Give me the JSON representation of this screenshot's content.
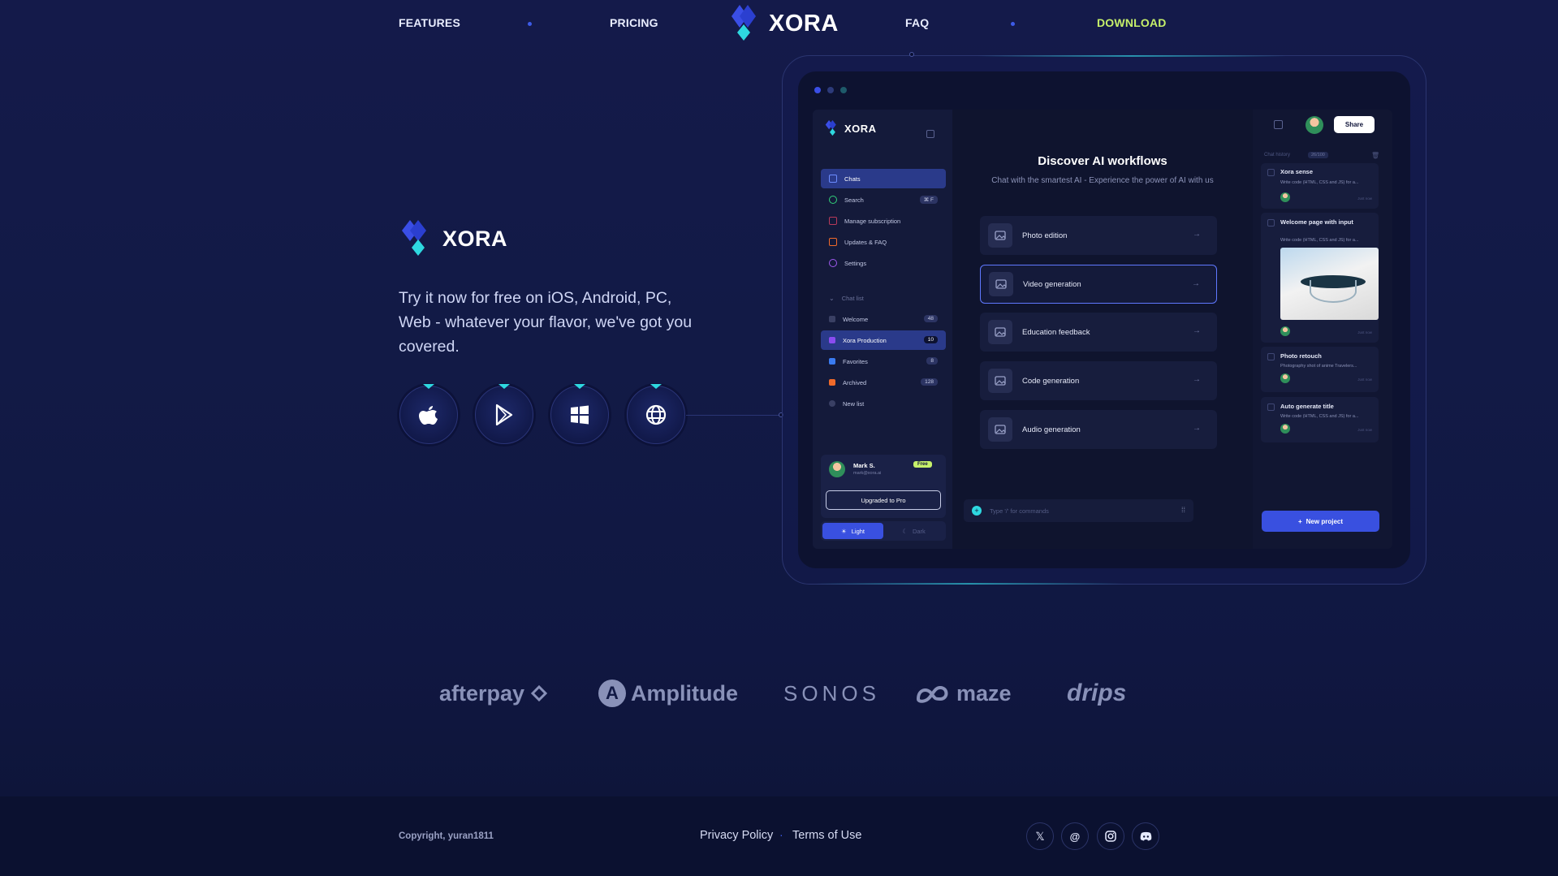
{
  "nav": {
    "features": "FEATURES",
    "pricing": "PRICING",
    "brand": "XORA",
    "faq": "FAQ",
    "download": "DOWNLOAD"
  },
  "hero": {
    "brand": "XORA",
    "tagline": "Try it now for free on iOS, Android, PC, Web - whatever your flavor, we've got you covered.",
    "stores": [
      {
        "icon": "apple-icon"
      },
      {
        "icon": "google-play-icon"
      },
      {
        "icon": "windows-icon"
      },
      {
        "icon": "globe-icon"
      }
    ]
  },
  "app": {
    "brand": "XORA",
    "sidebar": {
      "items": [
        {
          "label": "Chats",
          "icon": "chat-icon"
        },
        {
          "label": "Search",
          "icon": "search-icon",
          "shortcut": "⌘ F"
        },
        {
          "label": "Manage subscription",
          "icon": "card-icon"
        },
        {
          "label": "Updates & FAQ",
          "icon": "updates-icon"
        },
        {
          "label": "Settings",
          "icon": "settings-icon"
        }
      ],
      "chat_list_label": "Chat list",
      "chat_list": [
        {
          "label": "Welcome",
          "count": "48",
          "color": "#3a4064"
        },
        {
          "label": "Xora Production",
          "count": "10",
          "color": "#8a4cf0"
        },
        {
          "label": "Favorites",
          "count": "8",
          "color": "#3a7bf0"
        },
        {
          "label": "Archived",
          "count": "128",
          "color": "#f06a2a"
        },
        {
          "label": "New list",
          "count": "",
          "color": "#3a4064"
        }
      ],
      "user": {
        "name": "Mark S.",
        "email": "mark@xora.ai",
        "plan": "Free",
        "upgrade": "Upgraded to Pro"
      },
      "theme": {
        "light": "Light",
        "dark": "Dark"
      }
    },
    "main": {
      "title": "Discover AI workflows",
      "subtitle": "Chat with the smartest AI - Experience the power of AI with us",
      "workflows": [
        {
          "label": "Photo edition"
        },
        {
          "label": "Video generation"
        },
        {
          "label": "Education feedback"
        },
        {
          "label": "Code generation"
        },
        {
          "label": "Audio generation"
        }
      ],
      "command_placeholder": "Type '/' for commands"
    },
    "right": {
      "share": "Share",
      "chat_history": "Chat history",
      "history_count": "26/100",
      "history": [
        {
          "title": "Xora sense",
          "desc": "Write code (HTML, CSS and JS) for a..."
        },
        {
          "title": "Welcome page with input",
          "desc": "Write code (HTML, CSS and JS) for a..."
        },
        {
          "title": "Photo retouch",
          "desc": "Photography shot of anime Travelers..."
        },
        {
          "title": "Auto generate title",
          "desc": "Write code (HTML, CSS and JS) for a..."
        }
      ],
      "just_now": "Just now",
      "new_project": "New project"
    }
  },
  "partners": [
    "afterpay",
    "Amplitude",
    "SONOS",
    "maze",
    "drips"
  ],
  "footer": {
    "copyright": "Copyright, yuran1811",
    "privacy": "Privacy Policy",
    "terms": "Terms of Use",
    "separator": "·",
    "socials": [
      "x-icon",
      "threads-icon",
      "instagram-icon",
      "discord-icon"
    ]
  },
  "colors": {
    "accent": "#3950e0",
    "cyan": "#2ed8e0",
    "download": "#c6f06a"
  }
}
